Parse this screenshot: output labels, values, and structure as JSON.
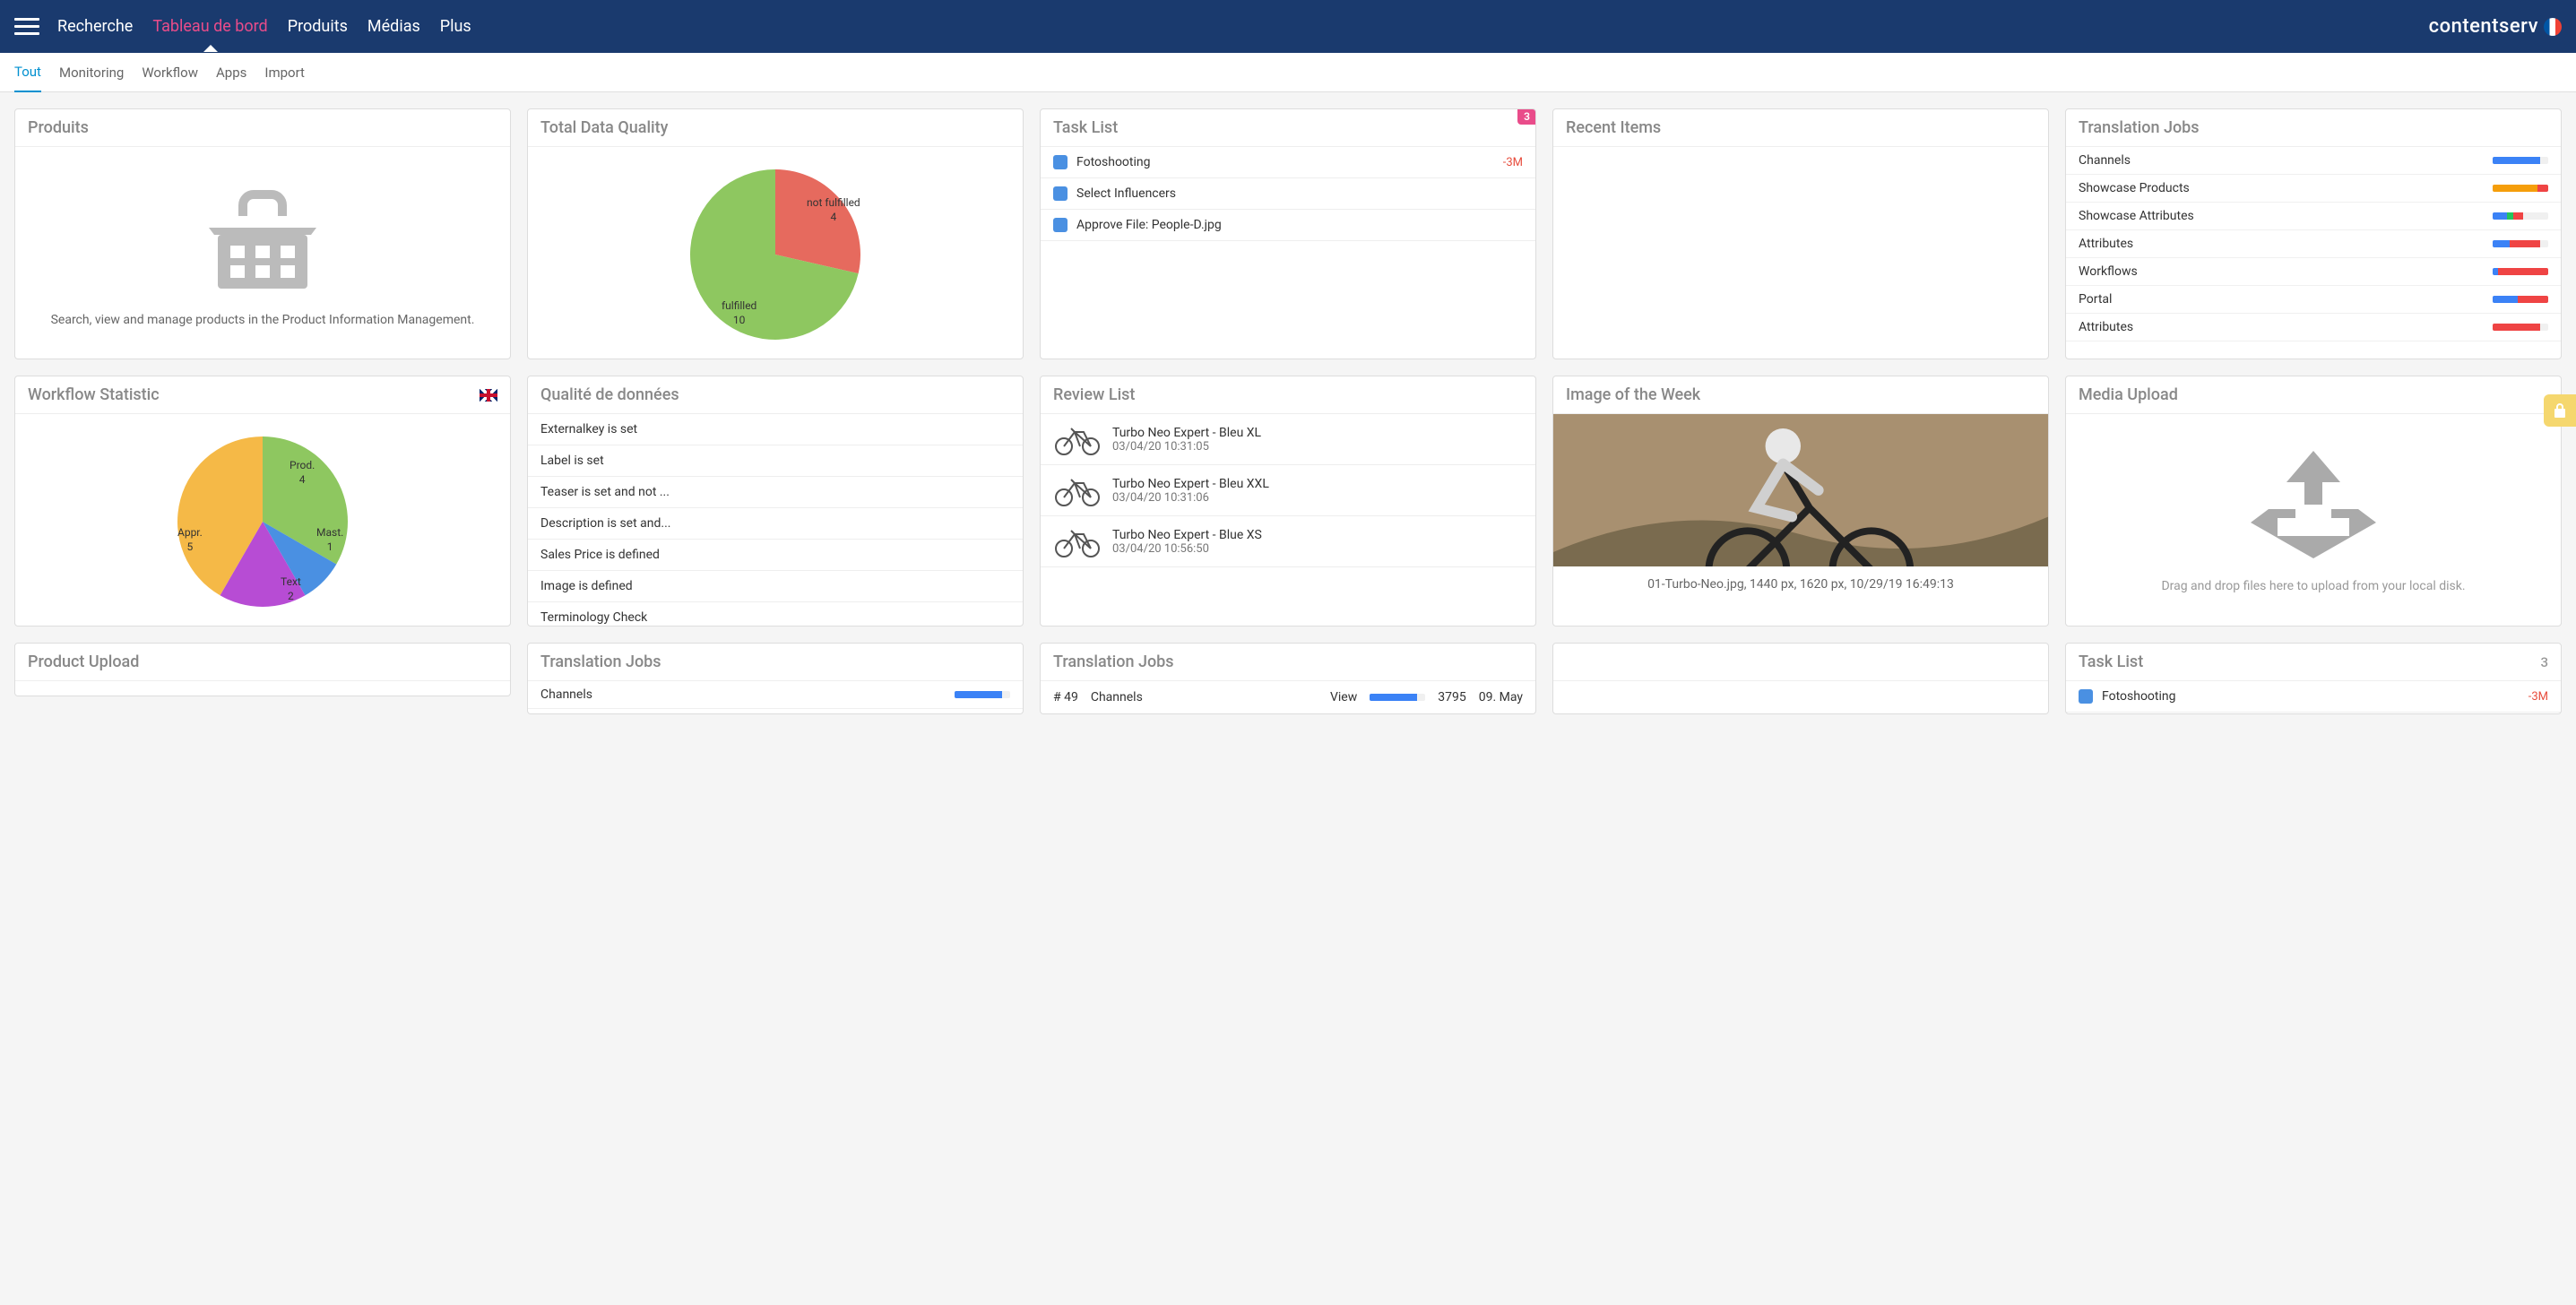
{
  "header": {
    "nav": [
      "Recherche",
      "Tableau de bord",
      "Produits",
      "Médias",
      "Plus"
    ],
    "active": 1,
    "brand": "contentserv"
  },
  "subnav": {
    "items": [
      "Tout",
      "Monitoring",
      "Workflow",
      "Apps",
      "Import"
    ],
    "active": 0
  },
  "widgets": {
    "produits": {
      "title": "Produits",
      "desc": "Search, view and manage products in the Product Information Management."
    },
    "dataQuality": {
      "title": "Total Data Quality",
      "slices": [
        {
          "label": "not fulfilled",
          "value": 4,
          "color": "#e66a5e"
        },
        {
          "label": "fulfilled",
          "value": 10,
          "color": "#8ec760"
        }
      ]
    },
    "taskList": {
      "title": "Task List",
      "badge": "3",
      "items": [
        {
          "label": "Fotoshooting",
          "time": "-3M"
        },
        {
          "label": "Select Influencers",
          "time": ""
        },
        {
          "label": "Approve File: People-D.jpg",
          "time": ""
        }
      ]
    },
    "recentItems": {
      "title": "Recent Items"
    },
    "translationJobs": {
      "title": "Translation Jobs",
      "rows": [
        {
          "label": "Channels",
          "segs": [
            [
              "#3b82f6",
              85
            ]
          ]
        },
        {
          "label": "Showcase Products",
          "segs": [
            [
              "#f59e0b",
              80
            ],
            [
              "#ef4444",
              20
            ]
          ]
        },
        {
          "label": "Showcase Attributes",
          "segs": [
            [
              "#3b82f6",
              25
            ],
            [
              "#22c55e",
              12
            ],
            [
              "#ef4444",
              18
            ]
          ]
        },
        {
          "label": "Attributes",
          "segs": [
            [
              "#3b82f6",
              30
            ],
            [
              "#ef4444",
              55
            ]
          ]
        },
        {
          "label": "Workflows",
          "segs": [
            [
              "#3b82f6",
              10
            ],
            [
              "#ef4444",
              90
            ]
          ]
        },
        {
          "label": "Portal",
          "segs": [
            [
              "#3b82f6",
              45
            ],
            [
              "#ef4444",
              55
            ]
          ]
        },
        {
          "label": "Attributes",
          "segs": [
            [
              "#ef4444",
              85
            ]
          ]
        }
      ]
    },
    "workflowStat": {
      "title": "Workflow Statistic",
      "slices": [
        {
          "label": "Prod.",
          "value": 4,
          "color": "#8ec760"
        },
        {
          "label": "Mast.",
          "value": 1,
          "color": "#4a90e2"
        },
        {
          "label": "Text",
          "value": 2,
          "color": "#b74cd4"
        },
        {
          "label": "Appr.",
          "value": 5,
          "color": "#f5b947"
        }
      ]
    },
    "qualiteDonnees": {
      "title": "Qualité de données",
      "items": [
        "Externalkey is set",
        "Label is set",
        "Teaser is set and not ...",
        "Description is set and...",
        "Sales Price is defined",
        "Image is defined",
        "Terminology Check"
      ]
    },
    "reviewList": {
      "title": "Review List",
      "items": [
        {
          "title": "Turbo Neo Expert - Bleu XL",
          "time": "03/04/20 10:31:05"
        },
        {
          "title": "Turbo Neo Expert - Bleu XXL",
          "time": "03/04/20 10:31:06"
        },
        {
          "title": "Turbo Neo Expert - Blue XS",
          "time": "03/04/20 10:56:50"
        }
      ]
    },
    "imageWeek": {
      "title": "Image of the Week",
      "caption": "01-Turbo-Neo.jpg, 1440 px, 1620 px, 10/29/19 16:49:13"
    },
    "mediaUpload": {
      "title": "Media Upload",
      "desc": "Drag and drop files here to upload from your local disk."
    },
    "productUpload": {
      "title": "Product Upload"
    },
    "tj2": {
      "title": "Translation Jobs",
      "r0": "Channels"
    },
    "tj3": {
      "title": "Translation Jobs",
      "row": {
        "c0": "# 49",
        "c1": "Channels",
        "c2": "View",
        "c3": "3795",
        "c4": "09. May"
      }
    },
    "taskList2": {
      "title": "Task List",
      "badge": "3",
      "items": [
        {
          "label": "Fotoshooting",
          "time": "-3M"
        }
      ]
    }
  },
  "chart_data": [
    {
      "type": "pie",
      "title": "Total Data Quality",
      "categories": [
        "not fulfilled",
        "fulfilled"
      ],
      "values": [
        4,
        10
      ],
      "colors": [
        "#e66a5e",
        "#8ec760"
      ]
    },
    {
      "type": "pie",
      "title": "Workflow Statistic",
      "categories": [
        "Prod.",
        "Mast.",
        "Text",
        "Appr."
      ],
      "values": [
        4,
        1,
        2,
        5
      ],
      "colors": [
        "#8ec760",
        "#4a90e2",
        "#b74cd4",
        "#f5b947"
      ]
    }
  ]
}
